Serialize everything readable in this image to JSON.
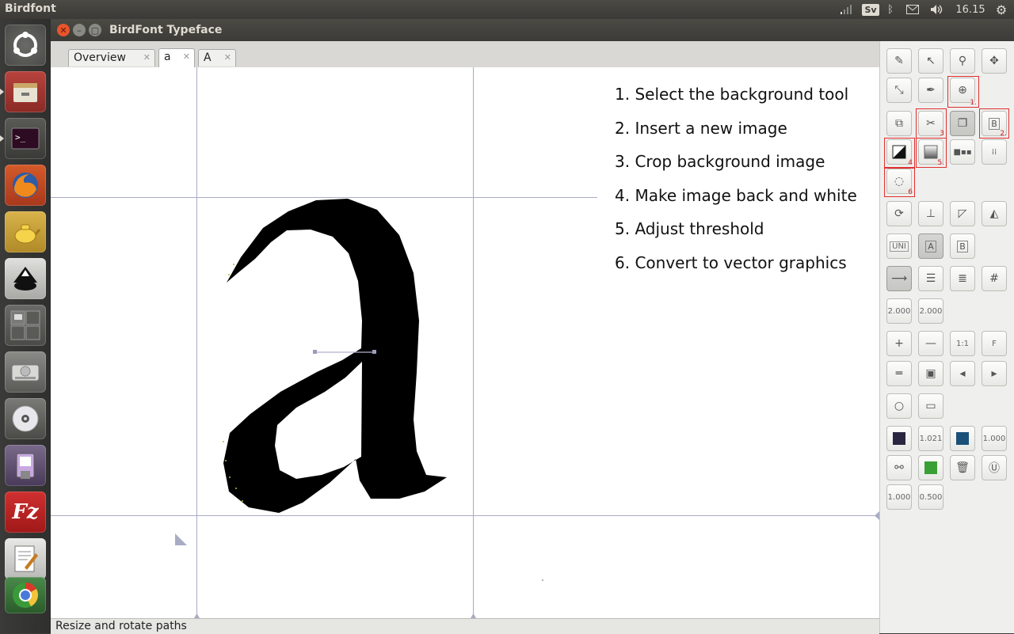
{
  "system": {
    "app_name": "Birdfont",
    "keyboard_layout": "Sv",
    "clock": "16.15"
  },
  "window": {
    "title": "BirdFont Typeface"
  },
  "tabs": [
    {
      "label": "Overview"
    },
    {
      "label": "a"
    },
    {
      "label": "A"
    }
  ],
  "canvas": {
    "glyph": "a",
    "instructions": [
      "1. Select the background tool",
      "2. Insert a new image",
      "3. Crop background image",
      "4. Make image back and white",
      "5. Adjust threshold",
      "6. Convert to vector graphics"
    ]
  },
  "toolbox": {
    "highlight_numbers": [
      "1.",
      "2.",
      "3",
      "4",
      "5.",
      "6"
    ],
    "values": {
      "uni": "UNI",
      "width_1": "2.000",
      "width_2": "2.000",
      "zoom_one": "1:1",
      "fit": "F",
      "fill_alpha": "1.021",
      "stroke_alpha": "1.000",
      "val_a": "1.000",
      "val_b": "0.500"
    },
    "colors": {
      "fill": "#2a2540",
      "stroke": "#1b5078",
      "green": "#3aa035",
      "highlight": "#e03030"
    }
  },
  "status": {
    "text": "Resize and rotate paths"
  }
}
